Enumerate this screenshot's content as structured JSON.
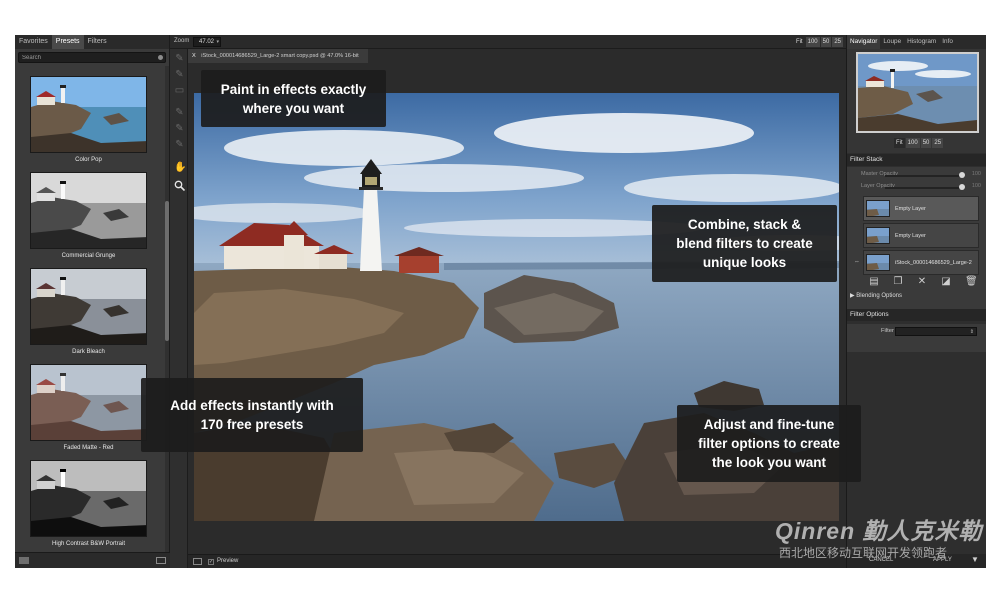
{
  "left_panel": {
    "tabs": [
      "Favorites",
      "Presets",
      "Filters"
    ],
    "active_tab": "Presets",
    "search_placeholder": "Search",
    "presets": [
      "Color Pop",
      "Commercial Grunge",
      "Dark Bleach",
      "Faded Matte - Red",
      "High Contrast B&W Portrait"
    ]
  },
  "topbar": {
    "zoom_label": "Zoom",
    "zoom_value": "47.02",
    "zoom_buttons": [
      "Fit",
      "100",
      "50",
      "25"
    ]
  },
  "document": {
    "close": "X",
    "tab_title": "iStock_000014686529_Large-2 smart copy.psd @ 47.0% 16-bit"
  },
  "bottombar": {
    "preview_label": "Preview"
  },
  "right_panel": {
    "tabs": [
      "Navigator",
      "Loupe",
      "Histogram",
      "Info"
    ],
    "active_tab": "Navigator",
    "nav_zoom_buttons": [
      "Fit",
      "100",
      "50",
      "25"
    ],
    "filter_stack": {
      "title": "Filter Stack",
      "master_opacity_label": "Master Opacity",
      "master_opacity_value": "100",
      "layer_opacity_label": "Layer Opacity",
      "layer_opacity_value": "100",
      "layers": [
        "Empty Layer",
        "Empty Layer",
        "iStock_000014686529_Large-2"
      ],
      "blending_options": "Blending Options"
    },
    "filter_options": {
      "title": "Filter Options",
      "filter_label": "Filter"
    },
    "buttons": {
      "cancel": "CANCEL",
      "apply": "APPLY"
    }
  },
  "callouts": {
    "paint": "Paint in effects exactly\nwhere you want",
    "combine": "Combine, stack &\nblend filters to create\nunique looks",
    "add": "Add effects instantly with\n170 free presets",
    "adjust": "Adjust and fine-tune\nfilter options to create\nthe look you want"
  },
  "watermark": {
    "logo": "Qinren 勤人克米勒",
    "subtitle": "西北地区移动互联网开发领跑者"
  },
  "colors": {
    "app_bg": "#2b2b2b",
    "panel_bg": "#3a3a3a",
    "callout_bg": "#1c1c1c",
    "sky": "#4a74a8",
    "sea": "#6a8db0"
  },
  "icons": {
    "tools": [
      "brush-icon",
      "brush-icon",
      "eraser-icon",
      "brush-icon",
      "brush-icon",
      "hand-icon",
      "zoom-icon"
    ],
    "layer_tools": [
      "new-layer-icon",
      "duplicate-layer-icon",
      "merge-icon",
      "add-mask-icon",
      "trash-icon"
    ]
  }
}
